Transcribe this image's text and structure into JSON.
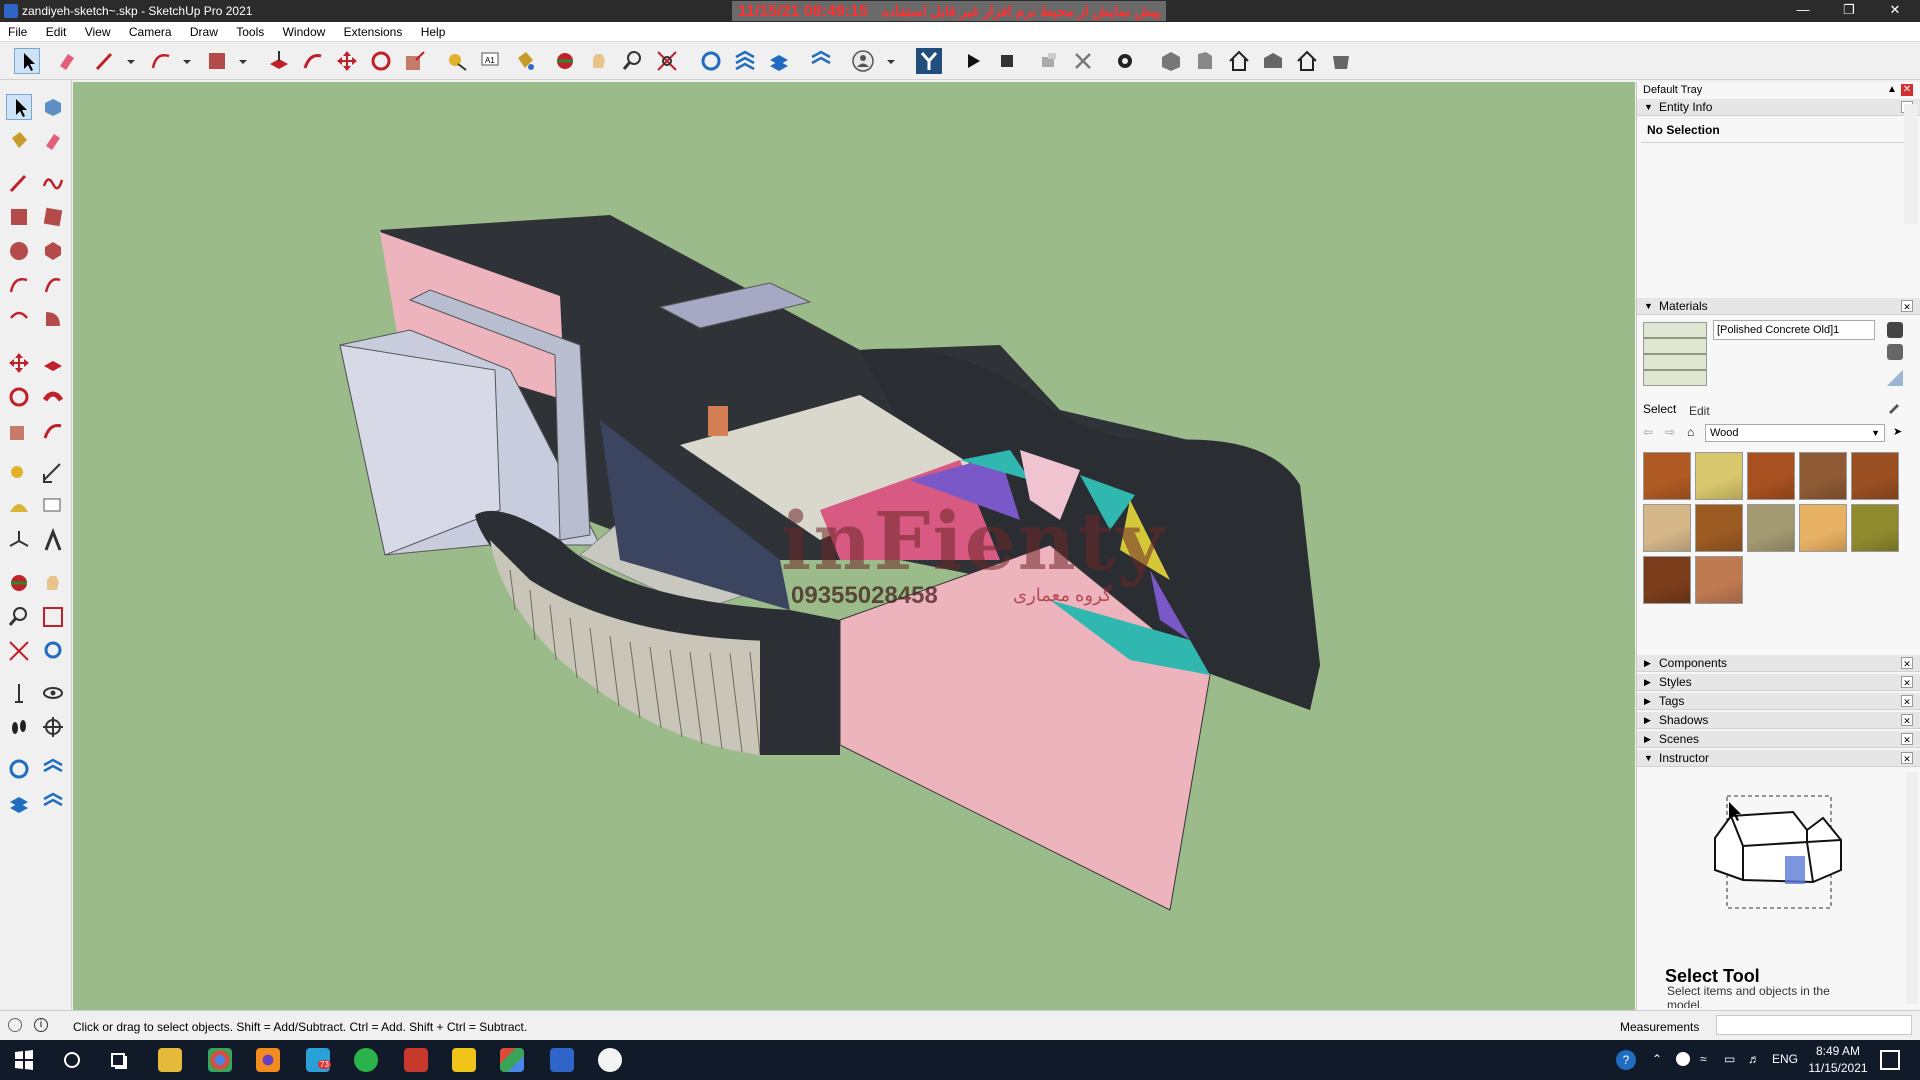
{
  "window": {
    "title": "zandiyeh-sketch~.skp - SketchUp Pro 2021",
    "trial_date": "11/15/21  08:49:15",
    "trial_text": "پیش نمایش از محیط نرم افزار غیر قابل استفاده"
  },
  "menu": [
    "File",
    "Edit",
    "View",
    "Camera",
    "Draw",
    "Tools",
    "Window",
    "Extensions",
    "Help"
  ],
  "tray": {
    "title": "Default Tray",
    "entity_info": {
      "label": "Entity Info",
      "selection": "No Selection"
    },
    "materials": {
      "label": "Materials",
      "name_value": "[Polished Concrete Old]1",
      "tab_select": "Select",
      "tab_edit": "Edit",
      "library": "Wood",
      "swatch_colors": [
        "#b05a23",
        "#d8c76c",
        "#a8501f",
        "#8e5a34",
        "#9a4f22",
        "#d5b78a",
        "#9b5a22",
        "#a39a72",
        "#e8b264",
        "#8f8a2e",
        "#7a3d1b",
        "#c07a52"
      ]
    },
    "collapsed_panels": [
      "Components",
      "Styles",
      "Tags",
      "Shadows",
      "Scenes"
    ],
    "instructor": {
      "label": "Instructor",
      "tool_title": "Select Tool",
      "tool_desc": "Select items and objects in the model."
    }
  },
  "watermark": {
    "brand": "inFienty",
    "phone": "09355028458",
    "sub": "گروه معماری"
  },
  "status": {
    "hint": "Click or drag to select objects. Shift = Add/Subtract. Ctrl = Add. Shift + Ctrl = Subtract.",
    "measurements_label": "Measurements"
  },
  "taskbar": {
    "time": "8:49 AM",
    "date": "11/15/2021",
    "lang": "ENG",
    "badge": "73"
  },
  "colors": {
    "viewport_bg": "#9cbb8b",
    "model_dark": "#2f3237",
    "model_pink": "#eeb4be",
    "taskbar": "#101a29"
  }
}
